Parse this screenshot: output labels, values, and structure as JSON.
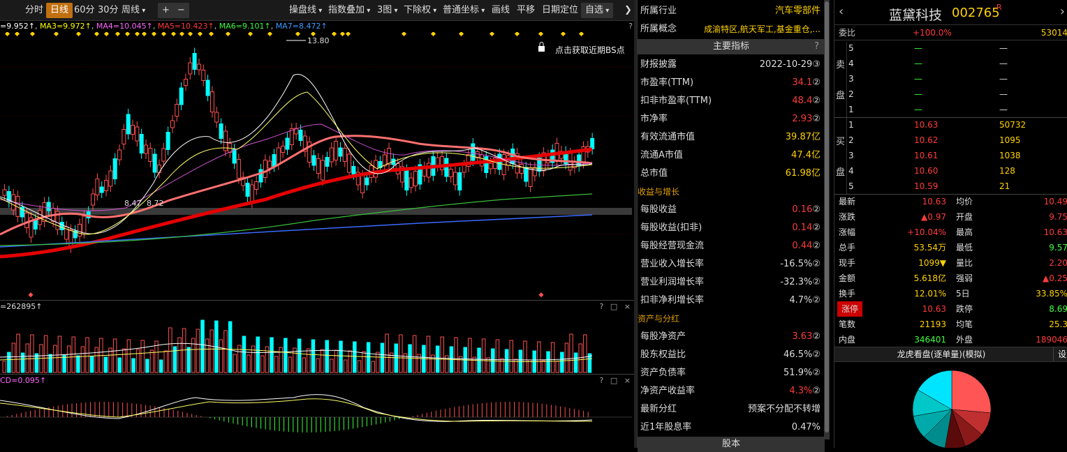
{
  "toolbar": {
    "period_tabs": [
      "分时",
      "日线",
      "60分",
      "30分",
      "周线"
    ],
    "zoom_in": "+",
    "zoom_out": "−",
    "buttons": [
      "操盘线",
      "指数叠加",
      "3图",
      "下除权",
      "普通坐标",
      "画线",
      "平移",
      "日期定位",
      "自选"
    ],
    "expand": "K"
  },
  "ma_legend": [
    {
      "text": "=9.952↑",
      "color": "#ffffff"
    },
    {
      "text": "MA3=9.972↑",
      "color": "#ffff00"
    },
    {
      "text": "MA4=10.045↑",
      "color": "#ff66ff"
    },
    {
      "text": "MA5=10.423↑",
      "color": "#ff3b3b"
    },
    {
      "text": "MA6=9.101↑",
      "color": "#3bff3b"
    },
    {
      "text": "MA7=8.472↑",
      "color": "#3b9bff"
    }
  ],
  "main_chart": {
    "high_label": "13.80",
    "low_label": "8.47",
    "low_label2": "8.72",
    "bs_point_text": "点击获取近期BS点"
  },
  "volume": {
    "label": "=262895↑"
  },
  "macd": {
    "label": "CD=0.095↑"
  },
  "panel_controls": "? □ ×",
  "info_panel": {
    "industry_label": "所属行业",
    "industry_value": "汽车零部件",
    "concept_label": "所属概念",
    "concept_value": "成渝特区,航天军工,基金重仓,...",
    "section_main": "主要指标",
    "section_growth": "收益与增长",
    "section_assets": "资产与分红",
    "section_equity": "股本",
    "rows": [
      {
        "k": "财报披露",
        "v": "2022-10-29",
        "mark": "③",
        "color": "#dddddd"
      },
      {
        "k": "市盈率(TTM)",
        "v": "34.1",
        "mark": "②",
        "color": "#ff3b3b"
      },
      {
        "k": "扣非市盈率(TTM)",
        "v": "48.4",
        "mark": "②",
        "color": "#ff3b3b"
      },
      {
        "k": "市净率",
        "v": "2.93",
        "mark": "②",
        "color": "#ff3b3b"
      },
      {
        "k": "有效流通市值",
        "v": "39.87亿",
        "mark": "",
        "color": "#ffd200"
      },
      {
        "k": "流通A市值",
        "v": "47.4亿",
        "mark": "",
        "color": "#ffd200"
      },
      {
        "k": "总市值",
        "v": "61.98亿",
        "mark": "",
        "color": "#ffd200"
      }
    ],
    "growth_rows": [
      {
        "k": "每股收益",
        "v": "0.16",
        "mark": "②",
        "color": "#ff3b3b"
      },
      {
        "k": "每股收益(扣非)",
        "v": "0.14",
        "mark": "②",
        "color": "#ff3b3b"
      },
      {
        "k": "每股经营现金流",
        "v": "0.44",
        "mark": "②",
        "color": "#ff3b3b"
      },
      {
        "k": "营业收入增长率",
        "v": "-16.5%",
        "mark": "②",
        "color": "#dddddd"
      },
      {
        "k": "营业利润增长率",
        "v": "-32.3%",
        "mark": "②",
        "color": "#dddddd"
      },
      {
        "k": "扣非净利增长率",
        "v": "4.7%",
        "mark": "②",
        "color": "#dddddd"
      }
    ],
    "asset_rows": [
      {
        "k": "每股净资产",
        "v": "3.63",
        "mark": "②",
        "color": "#ff3b3b"
      },
      {
        "k": "股东权益比",
        "v": "46.5%",
        "mark": "②",
        "color": "#dddddd"
      },
      {
        "k": "资产负债率",
        "v": "51.9%",
        "mark": "②",
        "color": "#dddddd"
      },
      {
        "k": "净资产收益率",
        "v": "4.3%",
        "mark": "②",
        "color": "#ff3b3b"
      },
      {
        "k": "最新分红",
        "v": "预案不分配不转增",
        "mark": "",
        "color": "#dddddd"
      },
      {
        "k": "近1年股息率",
        "v": "0.47%",
        "mark": "",
        "color": "#dddddd"
      }
    ]
  },
  "quote": {
    "name": "蓝黛科技",
    "code": "002765",
    "flag": "R",
    "weibi_label": "委比",
    "weibi_value": "+100.0%",
    "weibi_extra": "53014",
    "sell_side_label": [
      "卖",
      "盘"
    ],
    "buy_side_label": [
      "买",
      "盘"
    ],
    "sell": [
      {
        "lvl": "5",
        "price": "—",
        "vol": "—"
      },
      {
        "lvl": "4",
        "price": "—",
        "vol": "—"
      },
      {
        "lvl": "3",
        "price": "—",
        "vol": "—"
      },
      {
        "lvl": "2",
        "price": "—",
        "vol": "—"
      },
      {
        "lvl": "1",
        "price": "—",
        "vol": "—"
      }
    ],
    "buy": [
      {
        "lvl": "1",
        "price": "10.63",
        "vol": "50732"
      },
      {
        "lvl": "2",
        "price": "10.62",
        "vol": "1095"
      },
      {
        "lvl": "3",
        "price": "10.61",
        "vol": "1038"
      },
      {
        "lvl": "4",
        "price": "10.60",
        "vol": "128"
      },
      {
        "lvl": "5",
        "price": "10.59",
        "vol": "21"
      }
    ],
    "stats": [
      {
        "k1": "最新",
        "v1": "10.63",
        "c1": "#ff3b3b",
        "k2": "均价",
        "v2": "10.49",
        "c2": "#ff3b3b"
      },
      {
        "k1": "涨跌",
        "v1": "▲0.97",
        "c1": "#ff3b3b",
        "k2": "开盘",
        "v2": "9.75",
        "c2": "#ff3b3b"
      },
      {
        "k1": "涨幅",
        "v1": "+10.04%",
        "c1": "#ff3b3b",
        "k2": "最高",
        "v2": "10.63",
        "c2": "#ff3b3b"
      },
      {
        "k1": "总手",
        "v1": "53.54万",
        "c1": "#ffd200",
        "k2": "最低",
        "v2": "9.57",
        "c2": "#3bff3b"
      },
      {
        "k1": "现手",
        "v1": "1099▼",
        "c1": "#ffd200",
        "k2": "量比",
        "v2": "2.20",
        "c2": "#ff3b3b"
      },
      {
        "k1": "金额",
        "v1": "5.618亿",
        "c1": "#ffd200",
        "k2": "强弱",
        "v2": "▲0.25",
        "c2": "#ff3b3b"
      },
      {
        "k1": "换手",
        "v1": "12.01%",
        "c1": "#ffd200",
        "k2": "5日",
        "v2": "33.85%",
        "c2": "#ffd200"
      },
      {
        "k1": "涨停",
        "v1": "10.63",
        "c1": "#ff3b3b",
        "k2": "跌停",
        "v2": "8.69",
        "c2": "#3bff3b"
      },
      {
        "k1": "笔数",
        "v1": "21193",
        "c1": "#ffd200",
        "k2": "均笔",
        "v2": "25.3",
        "c2": "#ffd200"
      },
      {
        "k1": "内盘",
        "v1": "346401",
        "c1": "#3bff3b",
        "k2": "外盘",
        "v2": "189046",
        "c2": "#ff3b3b"
      }
    ],
    "dragon_title": "龙虎看盘(逐单量)(模拟)",
    "dragon_btn": "设"
  }
}
